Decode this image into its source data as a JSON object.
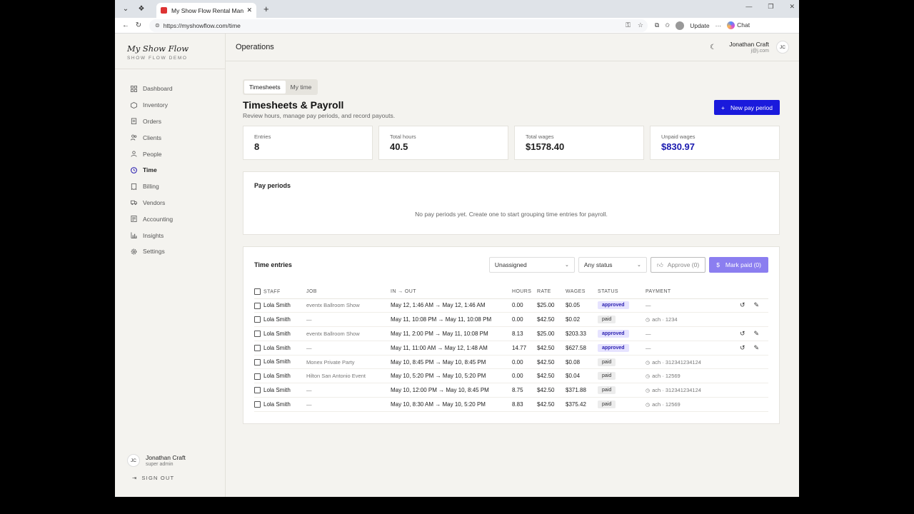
{
  "browser": {
    "tab_title": "My Show Flow Rental Management",
    "url": "https://myshowflow.com/time",
    "update_label": "Update",
    "chat_label": "Chat"
  },
  "brand": {
    "name": "My Show Flow",
    "sub": "SHOW FLOW DEMO"
  },
  "sidebar": {
    "items": [
      {
        "label": "Dashboard",
        "icon": "grid-icon"
      },
      {
        "label": "Inventory",
        "icon": "box-icon"
      },
      {
        "label": "Orders",
        "icon": "clipboard-icon"
      },
      {
        "label": "Clients",
        "icon": "users-icon"
      },
      {
        "label": "People",
        "icon": "user-icon"
      },
      {
        "label": "Time",
        "icon": "clock-icon",
        "active": true
      },
      {
        "label": "Billing",
        "icon": "receipt-icon"
      },
      {
        "label": "Vendors",
        "icon": "truck-icon"
      },
      {
        "label": "Accounting",
        "icon": "ledger-icon"
      },
      {
        "label": "Insights",
        "icon": "chart-icon"
      },
      {
        "label": "Settings",
        "icon": "gear-icon"
      }
    ],
    "user": {
      "initials": "JC",
      "name": "Jonathan Craft",
      "role": "super admin"
    },
    "signout": "SIGN OUT"
  },
  "topbar": {
    "section": "Operations",
    "user_name": "Jonathan Craft",
    "user_email": "j@j.com",
    "initials": "JC"
  },
  "content": {
    "tabs": [
      "Timesheets",
      "My time"
    ],
    "title": "Timesheets & Payroll",
    "subtitle": "Review hours, manage pay periods, and record payouts.",
    "new_button": "New pay period",
    "stats": [
      {
        "label": "Entries",
        "value": "8"
      },
      {
        "label": "Total hours",
        "value": "40.5"
      },
      {
        "label": "Total wages",
        "value": "$1578.40"
      },
      {
        "label": "Unpaid wages",
        "value": "$830.97"
      }
    ],
    "pay_periods": {
      "title": "Pay periods",
      "empty": "No pay periods yet. Create one to start grouping time entries for payroll."
    },
    "entries": {
      "title": "Time entries",
      "filter_assign": "Unassigned",
      "filter_status": "Any status",
      "approve_label": "Approve (0)",
      "markpaid_label": "Mark paid (0)",
      "columns": [
        "STAFF",
        "JOB",
        "IN → OUT",
        "HOURS",
        "RATE",
        "WAGES",
        "STATUS",
        "PAYMENT"
      ],
      "rows": [
        {
          "staff": "Lola Smith",
          "job": "eventx Ballroom Show",
          "inout": "May 12, 1:46 AM → May 12, 1:46 AM",
          "hours": "0.00",
          "rate": "$25.00",
          "wages": "$0.05",
          "status": "approved",
          "payment": "—",
          "actions": true
        },
        {
          "staff": "Lola Smith",
          "job": "—",
          "inout": "May 11, 10:08 PM → May 11, 10:08 PM",
          "hours": "0.00",
          "rate": "$42.50",
          "wages": "$0.02",
          "status": "paid",
          "payment": "ach · 1234",
          "actions": false
        },
        {
          "staff": "Lola Smith",
          "job": "eventx Ballroom Show",
          "inout": "May 11, 2:00 PM → May 11, 10:08 PM",
          "hours": "8.13",
          "rate": "$25.00",
          "wages": "$203.33",
          "status": "approved",
          "payment": "—",
          "actions": true
        },
        {
          "staff": "Lola Smith",
          "job": "—",
          "inout": "May 11, 11:00 AM → May 12, 1:48 AM",
          "hours": "14.77",
          "rate": "$42.50",
          "wages": "$627.58",
          "status": "approved",
          "payment": "—",
          "actions": true
        },
        {
          "staff": "Lola Smith",
          "job": "Monex Private Party",
          "inout": "May 10, 8:45 PM → May 10, 8:45 PM",
          "hours": "0.00",
          "rate": "$42.50",
          "wages": "$0.08",
          "status": "paid",
          "payment": "ach · 312341234124",
          "actions": false
        },
        {
          "staff": "Lola Smith",
          "job": "Hilton San Antonio Event",
          "inout": "May 10, 5:20 PM → May 10, 5:20 PM",
          "hours": "0.00",
          "rate": "$42.50",
          "wages": "$0.04",
          "status": "paid",
          "payment": "ach · 12569",
          "actions": false
        },
        {
          "staff": "Lola Smith",
          "job": "—",
          "inout": "May 10, 12:00 PM → May 10, 8:45 PM",
          "hours": "8.75",
          "rate": "$42.50",
          "wages": "$371.88",
          "status": "paid",
          "payment": "ach · 312341234124",
          "actions": false
        },
        {
          "staff": "Lola Smith",
          "job": "—",
          "inout": "May 10, 8:30 AM → May 10, 5:20 PM",
          "hours": "8.83",
          "rate": "$42.50",
          "wages": "$375.42",
          "status": "paid",
          "payment": "ach · 12569",
          "actions": false
        }
      ]
    }
  },
  "colors": {
    "accent": "#1a1adc",
    "purple": "#8b7ef0",
    "approved_bg": "#e6e3ff"
  }
}
